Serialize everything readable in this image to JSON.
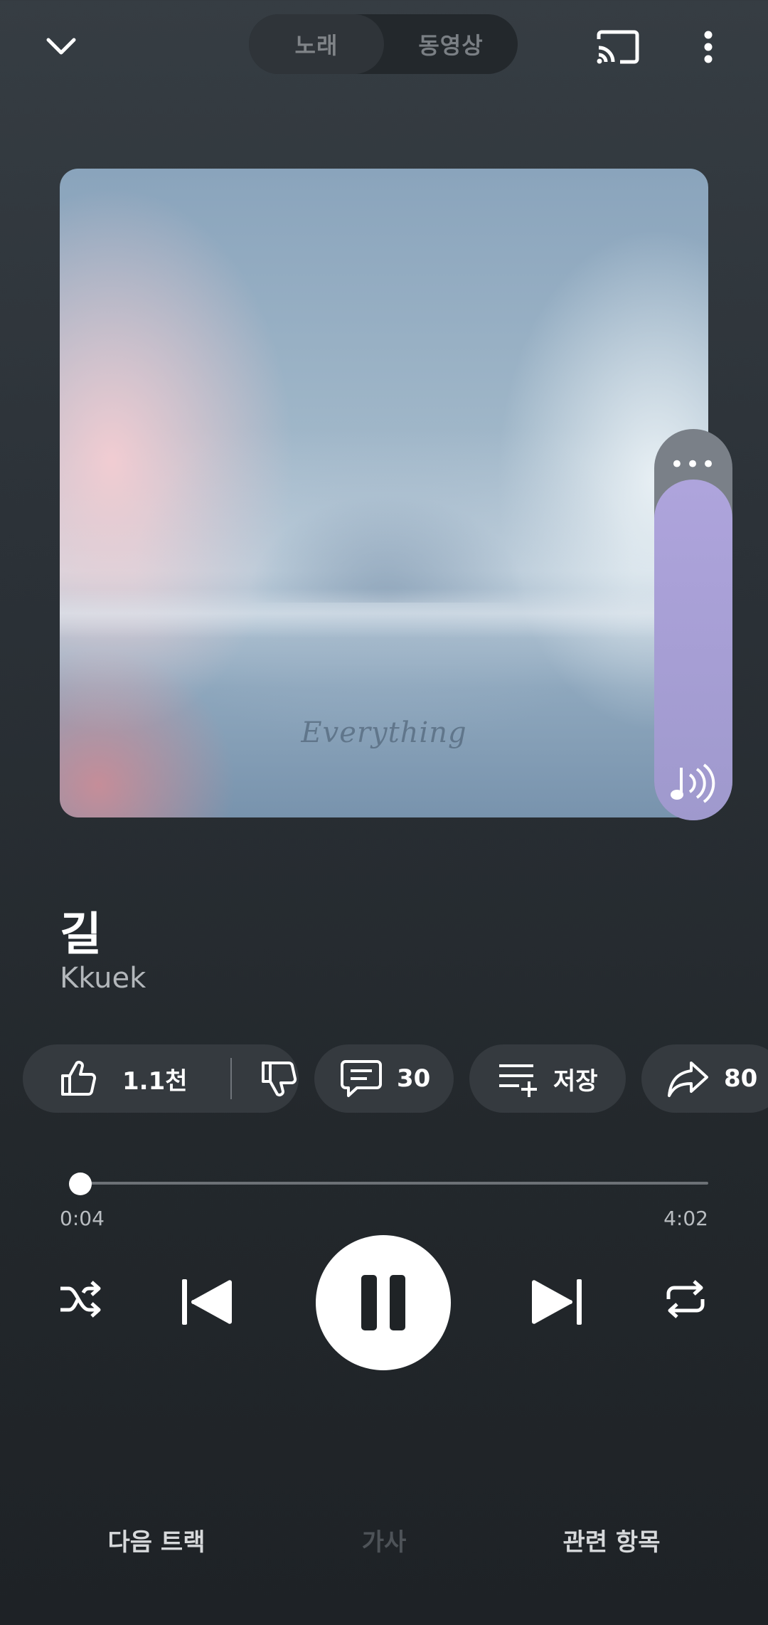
{
  "topbar": {
    "tabs": [
      {
        "label": "노래",
        "active": true
      },
      {
        "label": "동영상",
        "active": false
      }
    ],
    "icons": [
      "chevron-down-icon",
      "cast-icon",
      "more-vert-icon"
    ]
  },
  "artwork": {
    "text": "Everything",
    "colors": {
      "pink": "#f2ccd2",
      "blue": "#8ea7bd",
      "white": "#ebf2f6"
    }
  },
  "volume": {
    "level": 0.87,
    "dots": "•••",
    "accent": "#aea4dc"
  },
  "track": {
    "title": "길",
    "artist": "Kkuek"
  },
  "actions": {
    "likes": "1.1천",
    "comments": "30",
    "save": "저장",
    "shares": "80"
  },
  "progress": {
    "elapsed": "0:04",
    "duration": "4:02",
    "fraction": 0.017
  },
  "controls": {
    "state": "playing",
    "icons": [
      "shuffle-icon",
      "skip-previous-icon",
      "pause-icon",
      "skip-next-icon",
      "repeat-icon"
    ]
  },
  "bottom_tabs": [
    {
      "label": "다음 트랙",
      "dim": false
    },
    {
      "label": "가사",
      "dim": true
    },
    {
      "label": "관련 항목",
      "dim": false
    }
  ]
}
